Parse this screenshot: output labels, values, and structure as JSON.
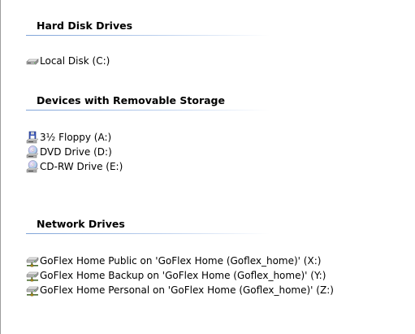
{
  "groups": [
    {
      "header": "Hard Disk Drives",
      "items": [
        {
          "label": "Local Disk (C:)",
          "icon": "hard-disk-icon"
        }
      ]
    },
    {
      "header": "Devices with Removable Storage",
      "items": [
        {
          "label": "3½ Floppy (A:)",
          "icon": "floppy-drive-icon"
        },
        {
          "label": "DVD Drive (D:)",
          "icon": "dvd-drive-icon"
        },
        {
          "label": "CD-RW Drive (E:)",
          "icon": "cd-drive-icon"
        }
      ]
    },
    {
      "header": "Network Drives",
      "items": [
        {
          "label": "GoFlex Home Public on 'GoFlex Home (Goflex_home)' (X:)",
          "icon": "network-drive-icon"
        },
        {
          "label": "GoFlex Home Backup on 'GoFlex Home (Goflex_home)' (Y:)",
          "icon": "network-drive-icon"
        },
        {
          "label": "GoFlex Home Personal on 'GoFlex Home (Goflex_home)' (Z:)",
          "icon": "network-drive-icon"
        }
      ]
    }
  ],
  "colors": {
    "group_line": "#80a4d8",
    "background": "#ffffff"
  }
}
